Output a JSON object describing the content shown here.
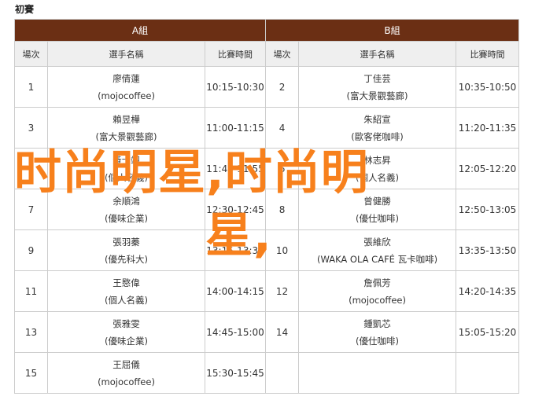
{
  "heading": "初賽",
  "groups": [
    {
      "label": "A組"
    },
    {
      "label": "B組"
    }
  ],
  "columns": {
    "round": "場次",
    "players": "選手名稱",
    "time": "比賽時間"
  },
  "rows": [
    {
      "a": {
        "round": "1",
        "p1": "廖倩蓮",
        "p2": "(mojocoffee)",
        "time": "10:15-10:30"
      },
      "b": {
        "round": "2",
        "p1": "丁佳芸",
        "p2": "(富大景觀藝廊)",
        "time": "10:35-10:50"
      }
    },
    {
      "a": {
        "round": "3",
        "p1": "賴昱樺",
        "p2": "(富大景觀藝廊)",
        "time": "11:00-11:15"
      },
      "b": {
        "round": "4",
        "p1": "朱紹宣",
        "p2": "(歐客佬咖啡)",
        "time": "11:20-11:35"
      }
    },
    {
      "a": {
        "round": "5",
        "p1": "黃士翊",
        "p2": "(個人名義)",
        "time": "11:40-11:55"
      },
      "b": {
        "round": "6",
        "p1": "林志昇",
        "p2": "(個人名義)",
        "time": "12:05-12:20"
      }
    },
    {
      "a": {
        "round": "7",
        "p1": "余順鴻",
        "p2": "(優味企業)",
        "time": "12:30-12:45"
      },
      "b": {
        "round": "8",
        "p1": "曾健勝",
        "p2": "(優仕咖啡)",
        "time": "12:50-13:05"
      }
    },
    {
      "a": {
        "round": "9",
        "p1": "張羽蓁",
        "p2": "(優先科大)",
        "time": "13:15-13:30"
      },
      "b": {
        "round": "10",
        "p1": "張維欣",
        "p2": "(WAKA OLA CAFÉ 瓦卡咖啡)",
        "time": "13:35-13:50"
      }
    },
    {
      "a": {
        "round": "11",
        "p1": "王愍偉",
        "p2": "(個人名義)",
        "time": "14:00-14:15"
      },
      "b": {
        "round": "12",
        "p1": "詹佩芳",
        "p2": "(mojocoffee)",
        "time": "14:20-14:35"
      }
    },
    {
      "a": {
        "round": "13",
        "p1": "張雅雯",
        "p2": "(優味企業)",
        "time": "14:45-15:00"
      },
      "b": {
        "round": "14",
        "p1": "鍾凱芯",
        "p2": "(優仕咖啡)",
        "time": "15:05-15:20"
      }
    },
    {
      "a": {
        "round": "15",
        "p1": "王屈儀",
        "p2": "(mojocoffee)",
        "time": "15:30-15:45"
      },
      "b": {
        "round": "",
        "p1": "",
        "p2": "",
        "time": ""
      }
    }
  ],
  "watermark": {
    "line1": "时尚明星,时尚明",
    "line2": "星,"
  },
  "colors": {
    "group_header_bg": "#6b2f14",
    "col_header_bg": "#efefef",
    "watermark": "#f7801c",
    "border": "#cccccc"
  }
}
